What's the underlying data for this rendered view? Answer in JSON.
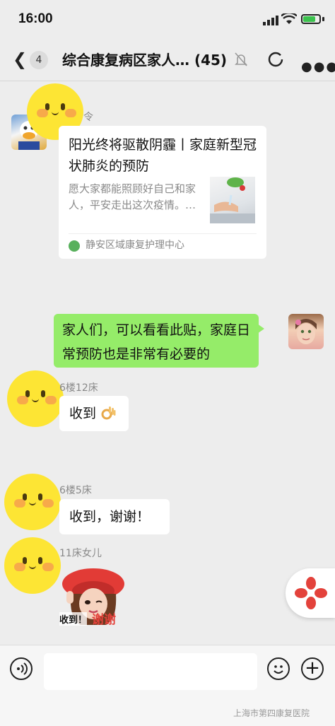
{
  "status_bar": {
    "time": "16:00",
    "battery_color": "#3bc24d"
  },
  "nav": {
    "unread_count": "4",
    "title": "综合康复病区家人… (45)",
    "icons": [
      "back-icon",
      "mute-icon",
      "refresh-icon",
      "more-icon"
    ]
  },
  "messages": [
    {
      "type": "link",
      "sender_name_fragment": "令",
      "title": "阳光终将驱散阴霾丨家庭新型冠状肺炎的预防",
      "desc": "愿大家都能照顾好自己和家人，平安走出这次疫情。…",
      "source": "静安区域康复护理中心"
    },
    {
      "type": "text",
      "outgoing": true,
      "text": "家人们，可以看看此贴，家庭日常预防也是非常有必要的"
    },
    {
      "type": "text",
      "sender_name": "6楼12床",
      "text": "收到"
    },
    {
      "type": "text",
      "sender_name": "6楼5床",
      "text": "收到，谢谢！"
    },
    {
      "type": "sticker",
      "sender_name": "11床女儿",
      "sticker_text_a": "收到！",
      "sticker_text_b": "谢谢"
    }
  ],
  "input_bar": {
    "placeholder": "",
    "watermark": "上海市第四康复医院"
  },
  "colors": {
    "background": "#ededed",
    "outgoing_bubble": "#95ec69",
    "incoming_bubble": "#ffffff",
    "accent_red": "#e3423b"
  }
}
